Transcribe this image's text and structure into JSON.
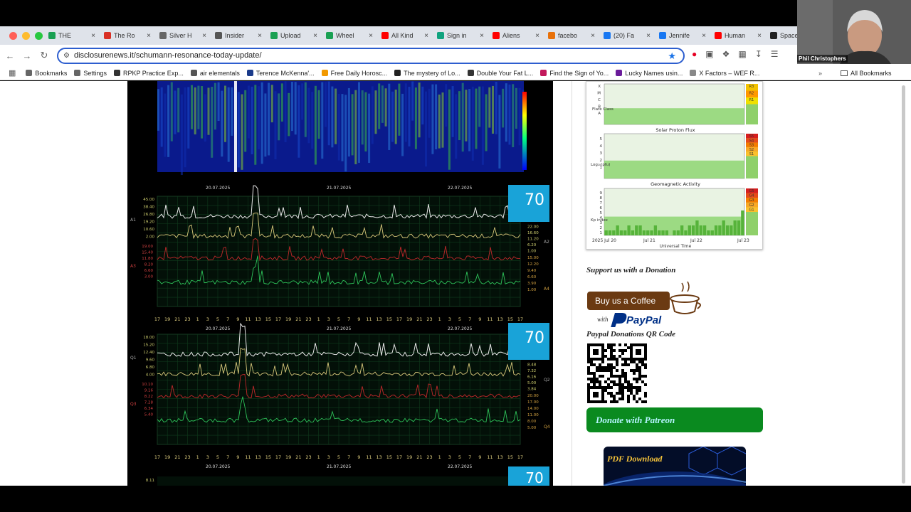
{
  "tabs": [
    {
      "title": "THE",
      "color": "#1aa053"
    },
    {
      "title": "The Ro",
      "color": "#d93025"
    },
    {
      "title": "Silver H",
      "color": "#666666"
    },
    {
      "title": "Insider",
      "color": "#555555"
    },
    {
      "title": "Upload",
      "color": "#1aa053"
    },
    {
      "title": "Wheel",
      "color": "#1aa053"
    },
    {
      "title": "All Kind",
      "color": "#ff0000"
    },
    {
      "title": "Sign in",
      "color": "#10a37f"
    },
    {
      "title": "Aliens",
      "color": "#ff0000"
    },
    {
      "title": "facebo",
      "color": "#e8710a"
    },
    {
      "title": "(20) Fa",
      "color": "#1877f2"
    },
    {
      "title": "Jennife",
      "color": "#1877f2"
    },
    {
      "title": "Human",
      "color": "#ff0000"
    },
    {
      "title": "Space",
      "color": "#222222"
    }
  ],
  "address": {
    "url": "disclosurenews.it/schumann-resonance-today-update/"
  },
  "bookmarks": [
    {
      "label": "Bookmarks",
      "color": "#666666"
    },
    {
      "label": "Settings",
      "color": "#666666"
    },
    {
      "label": "RPKP Practice Exp...",
      "color": "#333333"
    },
    {
      "label": "air elementals",
      "color": "#555555"
    },
    {
      "label": "Terence McKenna'...",
      "color": "#1a3a8a"
    },
    {
      "label": "Free Daily Horosc...",
      "color": "#f29900"
    },
    {
      "label": "The mystery of Lo...",
      "color": "#222222"
    },
    {
      "label": "Double Your Fat L...",
      "color": "#333333"
    },
    {
      "label": "Find the Sign of Yo...",
      "color": "#c2185b"
    },
    {
      "label": "Lucky Names usin...",
      "color": "#6a1b9a"
    },
    {
      "label": "X Factors – WEF R...",
      "color": "#888888"
    }
  ],
  "all_bookmarks": "All Bookmarks",
  "camera": {
    "name": "Phil Christophers"
  },
  "spectrogram": {
    "dates": [
      "20.07.2025",
      "21.07.2025",
      "22.07.2025"
    ]
  },
  "chart_a": {
    "left_label_top": "A1",
    "left_label_bottom": "A3",
    "right_label_top": "A2",
    "right_label_bottom": "A4",
    "left_ticks_top": [
      "45.00",
      "38.40",
      "26.80",
      "19.20",
      "10.60",
      "2.00"
    ],
    "left_ticks_bottom": [
      "19.00",
      "15.40",
      "11.80",
      "8.20",
      "6.60",
      "3.00"
    ],
    "right_ticks_top": [
      "27.50",
      "22.00",
      "16.60",
      "11.20",
      "6.20",
      "1.00"
    ],
    "right_ticks_bottom": [
      "15.00",
      "12.20",
      "9.40",
      "6.60",
      "3.90",
      "1.00"
    ],
    "hours": [
      "17",
      "19",
      "21",
      "23",
      "1",
      "3",
      "5",
      "7",
      "9",
      "11",
      "13",
      "15",
      "17",
      "19",
      "21",
      "23",
      "1",
      "3",
      "5",
      "7",
      "9",
      "11",
      "13",
      "15",
      "17",
      "19",
      "21",
      "23",
      "1",
      "3",
      "5",
      "7",
      "9",
      "11",
      "13",
      "15",
      "17"
    ],
    "dates": [
      "20.07.2025",
      "21.07.2025",
      "22.07.2025"
    ],
    "badge": "70"
  },
  "chart_q": {
    "left_label_top": "Q1",
    "left_label_bottom": "Q3",
    "right_label_top": "Q2",
    "right_label_bottom": "Q4",
    "left_ticks_top": [
      "18.00",
      "15.20",
      "12.40",
      "9.60",
      "6.80",
      "4.00"
    ],
    "left_ticks_bottom": [
      "10.10",
      "9.16",
      "8.22",
      "7.28",
      "6.34",
      "5.40"
    ],
    "right_ticks_top": [
      "9.64",
      "8.48",
      "7.32",
      "6.16",
      "5.00",
      "3.84"
    ],
    "right_ticks_bottom": [
      "20.00",
      "17.00",
      "14.00",
      "11.00",
      "8.00",
      "5.00"
    ],
    "hours": [
      "17",
      "19",
      "21",
      "23",
      "1",
      "3",
      "5",
      "7",
      "9",
      "11",
      "13",
      "15",
      "17",
      "19",
      "21",
      "23",
      "1",
      "3",
      "5",
      "7",
      "9",
      "11",
      "13",
      "15",
      "17",
      "19",
      "21",
      "23",
      "1",
      "3",
      "5",
      "7",
      "9",
      "11",
      "13",
      "15",
      "17"
    ],
    "dates": [
      "20.07.2025",
      "21.07.2025",
      "22.07.2025"
    ],
    "badge": "70"
  },
  "chart_third": {
    "first_tick": "8.11",
    "badge": "70"
  },
  "space_weather": {
    "flare_axis": "Flare Class",
    "flare_classes": [
      "X",
      "M",
      "C",
      "B",
      "A"
    ],
    "flare_levels": [
      "R3",
      "R2",
      "R1"
    ],
    "proton_title": "Solar Proton Flux",
    "proton_axis": "Log₁₀(pfu)",
    "proton_ticks": [
      "5",
      "4",
      "3",
      "2",
      "1"
    ],
    "proton_levels": [
      "S5",
      "S4",
      "S3",
      "S2",
      "S1"
    ],
    "geo_title": "Geomagnetic Activity",
    "kp_axis": "Kp index",
    "kp_ticks": [
      "9",
      "8",
      "7",
      "6",
      "5",
      "4",
      "3",
      "2",
      "1"
    ],
    "kp_levels": [
      "G5",
      "G4",
      "G3",
      "G2",
      "G1"
    ],
    "kp_values": [
      1,
      1,
      1,
      2,
      1,
      1,
      2,
      1,
      2,
      2,
      1,
      1,
      1,
      2,
      1,
      1,
      1,
      0,
      1,
      1,
      2,
      1,
      2,
      2,
      3,
      2,
      2,
      1,
      1,
      2,
      2,
      3,
      2,
      2,
      3,
      3,
      5
    ],
    "x_labels": [
      "2025 Jul 20",
      "Jul 21",
      "Jul 22",
      "Jul 23"
    ],
    "x_title": "Universal Time"
  },
  "sidebar": {
    "donation_title": "Support us with a Donation",
    "coffee_label": "Buy us a Coffee",
    "coffee_with": "with",
    "paypal_label": "PayPal",
    "qr_title": "Paypal Donations QR Code",
    "patreon_label": "Donate with Patreon",
    "pdf_label": "PDF Download"
  }
}
